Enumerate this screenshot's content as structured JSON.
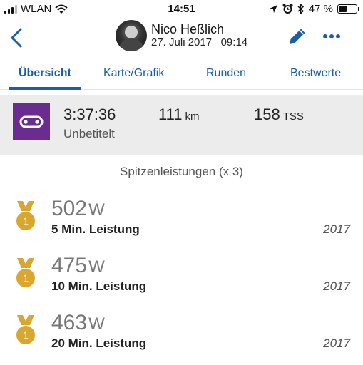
{
  "status_bar": {
    "carrier": "WLAN",
    "time": "14:51",
    "battery_percent": "47 %",
    "battery_level": 0.47
  },
  "header": {
    "name": "Nico Heßlich",
    "date": "27. Juli 2017",
    "time": "09:14"
  },
  "tabs": [
    {
      "label": "Übersicht",
      "active": true
    },
    {
      "label": "Karte/Grafik",
      "active": false
    },
    {
      "label": "Runden",
      "active": false
    },
    {
      "label": "Bestwerte",
      "active": false
    }
  ],
  "activity": {
    "icon": "bike-chain-icon",
    "icon_color": "#6a2c91",
    "duration": "3:37:36",
    "title": "Unbetitelt",
    "distance": "111",
    "distance_unit": "km",
    "tss": "158",
    "tss_unit": "TSS"
  },
  "records_heading": "Spitzenleistungen (x 3)",
  "records": [
    {
      "value": "502",
      "unit": "W",
      "label": "5 Min. Leistung",
      "year": "2017",
      "medal": "1"
    },
    {
      "value": "475",
      "unit": "W",
      "label": "10 Min. Leistung",
      "year": "2017",
      "medal": "1"
    },
    {
      "value": "463",
      "unit": "W",
      "label": "20 Min. Leistung",
      "year": "2017",
      "medal": "1"
    }
  ],
  "colors": {
    "accent": "#1a5ea8",
    "medal_gold": "#d9a62e",
    "summary_bg": "#ececec"
  }
}
